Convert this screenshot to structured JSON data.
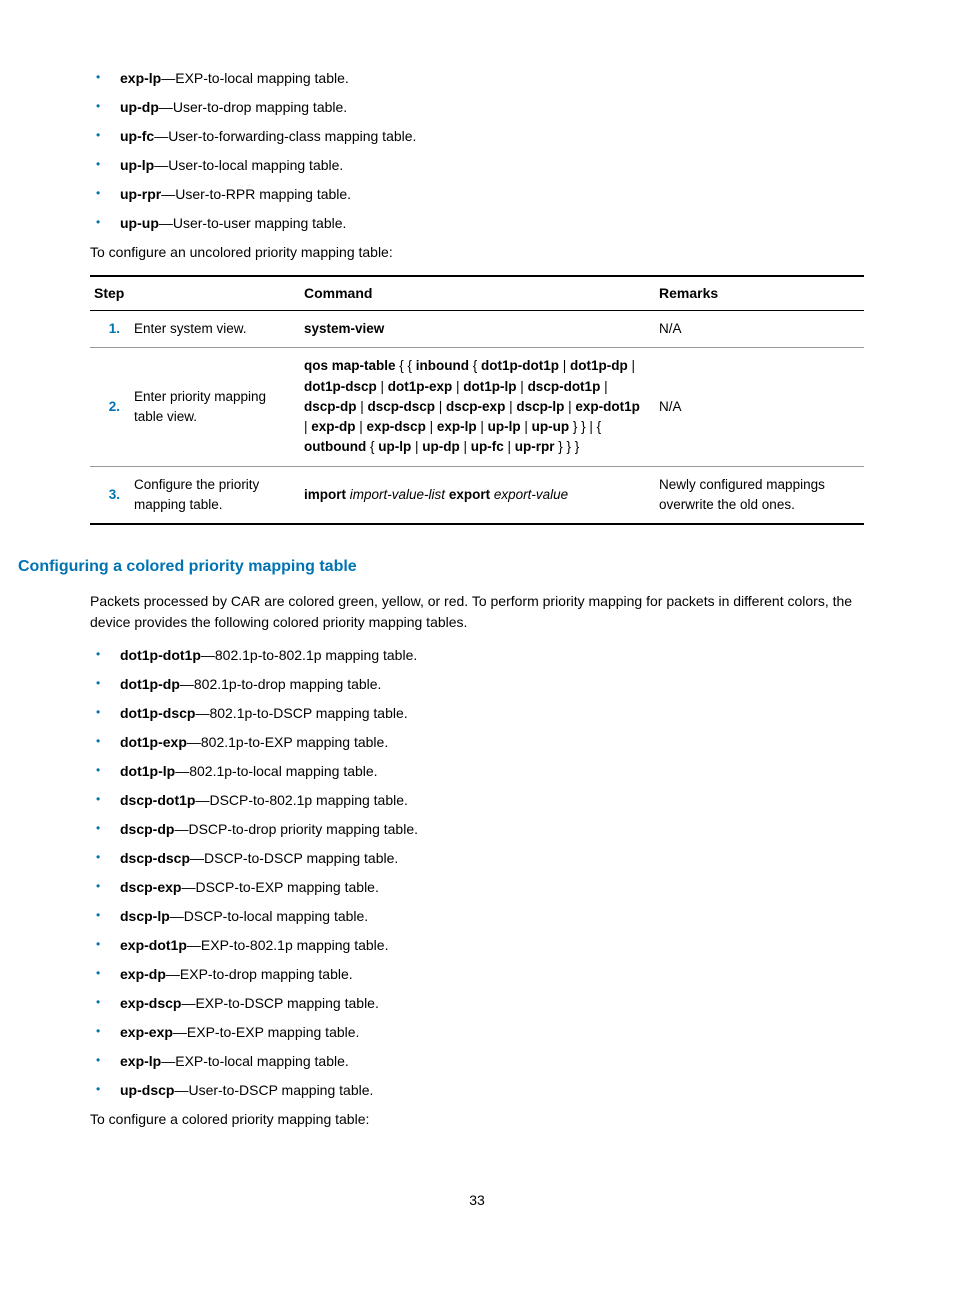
{
  "list1": [
    {
      "term": "exp-lp",
      "desc": "—EXP-to-local mapping table."
    },
    {
      "term": "up-dp",
      "desc": "—User-to-drop mapping table."
    },
    {
      "term": "up-fc",
      "desc": "—User-to-forwarding-class mapping table."
    },
    {
      "term": "up-lp",
      "desc": "—User-to-local mapping table."
    },
    {
      "term": "up-rpr",
      "desc": "—User-to-RPR mapping table."
    },
    {
      "term": "up-up",
      "desc": "—User-to-user mapping table."
    }
  ],
  "para1": "To configure an uncolored priority mapping table:",
  "table1": {
    "headers": {
      "step": "Step",
      "command": "Command",
      "remarks": "Remarks"
    },
    "rows": [
      {
        "num": "1.",
        "step": "Enter system view.",
        "command_html": "<b>system-view</b>",
        "remarks": "N/A"
      },
      {
        "num": "2.",
        "step": "Enter priority mapping table view.",
        "command_html": "<b>qos map-table</b> { { <b>inbound</b> { <b>dot1p-dot1p</b> | <b>dot1p-dp</b> | <b>dot1p-dscp</b> | <b>dot1p-exp</b> | <b>dot1p-lp</b> | <b>dscp-dot1p</b> | <b>dscp-dp</b> | <b>dscp-dscp</b> | <b>dscp-exp</b> | <b>dscp-lp</b> | <b>exp-dot1p</b> | <b>exp-dp</b> | <b>exp-dscp</b> | <b>exp-lp</b> | <b>up-lp</b> | <b>up-up</b> } } | { <b>outbound</b> { <b>up-lp</b> | <b>up-dp</b> | <b>up-fc</b> | <b>up-rpr</b> } } }",
        "remarks": "N/A"
      },
      {
        "num": "3.",
        "step": "Configure the priority mapping table.",
        "command_html": "<b>import</b> <i>import-value-list</i> <b>export</b> <i>export-value</i>",
        "remarks": "Newly configured mappings overwrite the old ones."
      }
    ]
  },
  "heading2": "Configuring a colored priority mapping table",
  "para2": "Packets processed by CAR are colored green, yellow, or red. To perform priority mapping for packets in different colors, the device provides the following colored priority mapping tables.",
  "list2": [
    {
      "term": "dot1p-dot1p",
      "desc": "—802.1p-to-802.1p mapping table."
    },
    {
      "term": "dot1p-dp",
      "desc": "—802.1p-to-drop mapping table."
    },
    {
      "term": "dot1p-dscp",
      "desc": "—802.1p-to-DSCP mapping table."
    },
    {
      "term": "dot1p-exp",
      "desc": "—802.1p-to-EXP mapping table."
    },
    {
      "term": "dot1p-lp",
      "desc": "—802.1p-to-local mapping table."
    },
    {
      "term": "dscp-dot1p",
      "desc": "—DSCP-to-802.1p mapping table."
    },
    {
      "term": "dscp-dp",
      "desc": "—DSCP-to-drop priority mapping table."
    },
    {
      "term": "dscp-dscp",
      "desc": "—DSCP-to-DSCP mapping table."
    },
    {
      "term": "dscp-exp",
      "desc": "—DSCP-to-EXP mapping table."
    },
    {
      "term": "dscp-lp",
      "desc": "—DSCP-to-local mapping table."
    },
    {
      "term": "exp-dot1p",
      "desc": "—EXP-to-802.1p mapping table."
    },
    {
      "term": "exp-dp",
      "desc": "—EXP-to-drop mapping table."
    },
    {
      "term": "exp-dscp",
      "desc": "—EXP-to-DSCP mapping table."
    },
    {
      "term": "exp-exp",
      "desc": "—EXP-to-EXP mapping table."
    },
    {
      "term": "exp-lp",
      "desc": "—EXP-to-local mapping table."
    },
    {
      "term": "up-dscp",
      "desc": "—User-to-DSCP mapping table."
    }
  ],
  "para3": "To configure a colored priority mapping table:",
  "pageNumber": "33"
}
